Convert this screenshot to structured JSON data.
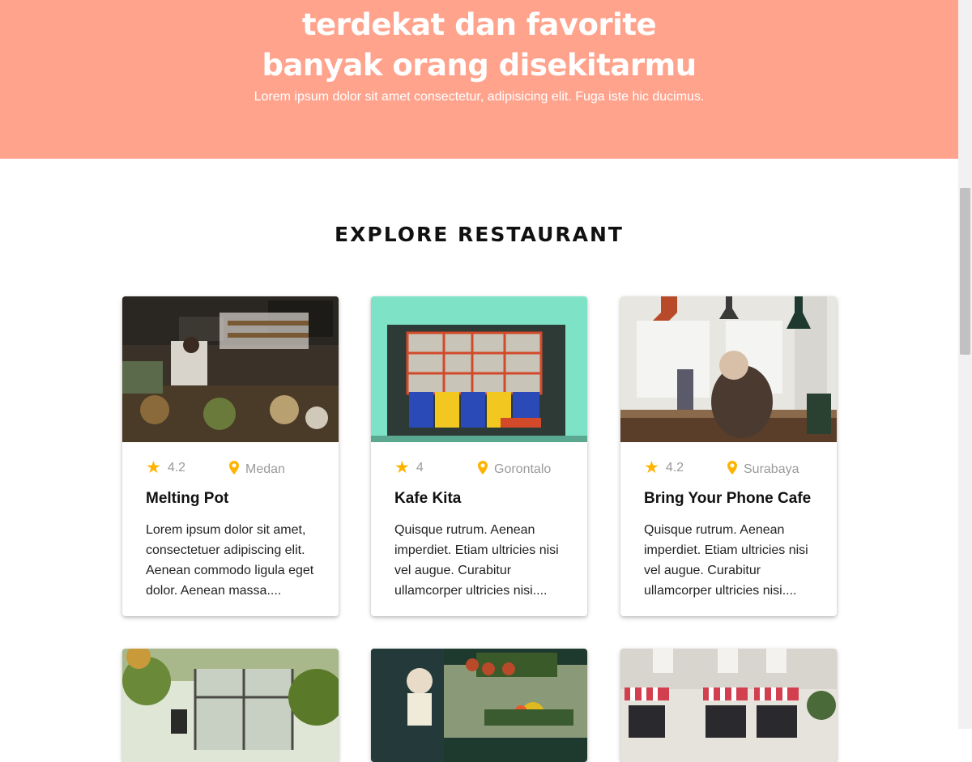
{
  "hero": {
    "line1": "terdekat dan favorite",
    "line2": "banyak orang disekitarmu",
    "subtitle": "Lorem ipsum dolor sit amet consectetur, adipisicing elit. Fuga iste hic ducimus."
  },
  "section": {
    "title": "EXPLORE RESTAURANT"
  },
  "restaurants": [
    {
      "rating": "4.2",
      "city": "Medan",
      "name": "Melting Pot",
      "description": "Lorem ipsum dolor sit amet, consectetuer adipiscing elit. Aenean commodo ligula eget dolor. Aenean massa...."
    },
    {
      "rating": "4",
      "city": "Gorontalo",
      "name": "Kafe Kita",
      "description": "Quisque rutrum. Aenean imperdiet. Etiam ultricies nisi vel augue. Curabitur ullamcorper ultricies nisi...."
    },
    {
      "rating": "4.2",
      "city": "Surabaya",
      "name": "Bring Your Phone Cafe",
      "description": "Quisque rutrum. Aenean imperdiet. Etiam ultricies nisi vel augue. Curabitur ullamcorper ultricies nisi...."
    }
  ],
  "icons": {
    "rating": "star-icon",
    "location": "location-pin-icon"
  },
  "colors": {
    "hero_bg": "#ffa38d",
    "star": "#ffb300",
    "pin": "#ffb300"
  }
}
